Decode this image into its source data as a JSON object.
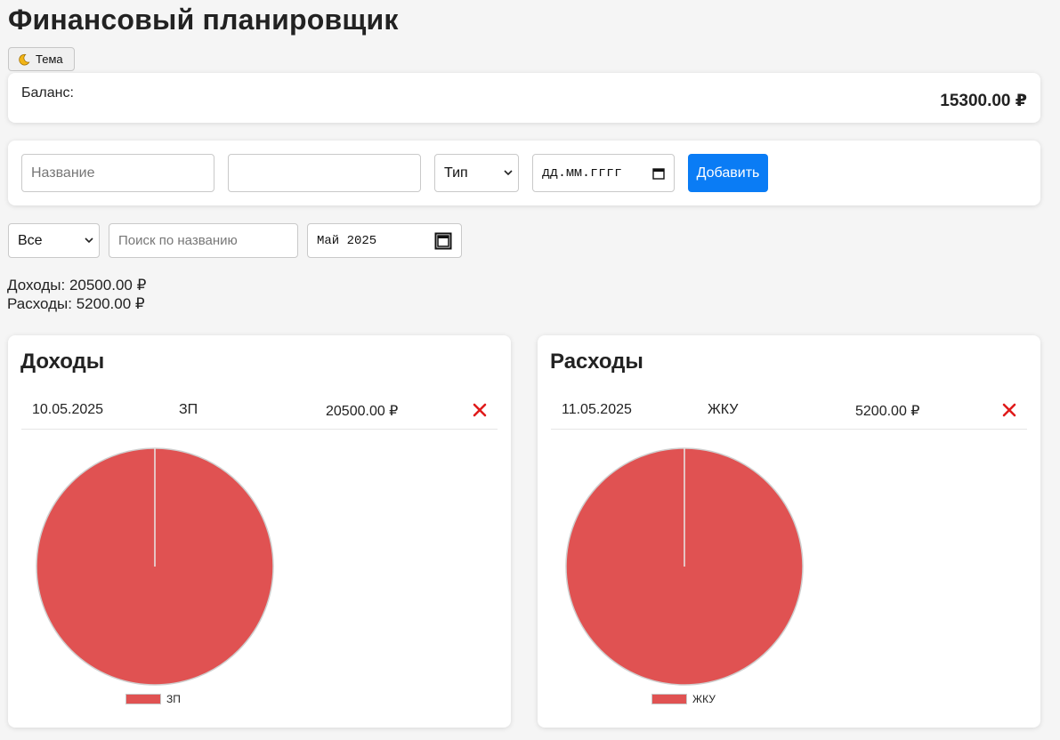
{
  "app": {
    "title": "Финансовый планировщик",
    "theme_button": "Тема"
  },
  "balance": {
    "label": "Баланс:",
    "value": "15300.00 ₽"
  },
  "form": {
    "name_placeholder": "Название",
    "amount_placeholder": "",
    "type_select": "Тип",
    "date_placeholder": "дд.мм.гггг",
    "add_button": "Добавить"
  },
  "filters": {
    "type_select": "Все",
    "search_placeholder": "Поиск по названию",
    "month": "Май 2025"
  },
  "totals": {
    "income": "Доходы: 20500.00 ₽",
    "expense": "Расходы: 5200.00 ₽"
  },
  "income": {
    "title": "Доходы",
    "rows": [
      {
        "date": "10.05.2025",
        "name": "ЗП",
        "amount": "20500.00 ₽"
      }
    ],
    "legend": "ЗП"
  },
  "expense": {
    "title": "Расходы",
    "rows": [
      {
        "date": "11.05.2025",
        "name": "ЖКУ",
        "amount": "5200.00 ₽"
      }
    ],
    "legend": "ЖКУ"
  },
  "colors": {
    "accent": "#0a7cf5",
    "pie_slice": "#e05252",
    "delete": "#e01b1b"
  },
  "chart_data": [
    {
      "type": "pie",
      "categories": [
        "ЗП"
      ],
      "values": [
        20500
      ],
      "title": "",
      "legend": "bottom"
    },
    {
      "type": "pie",
      "categories": [
        "ЖКУ"
      ],
      "values": [
        5200
      ],
      "title": "",
      "legend": "bottom"
    }
  ]
}
